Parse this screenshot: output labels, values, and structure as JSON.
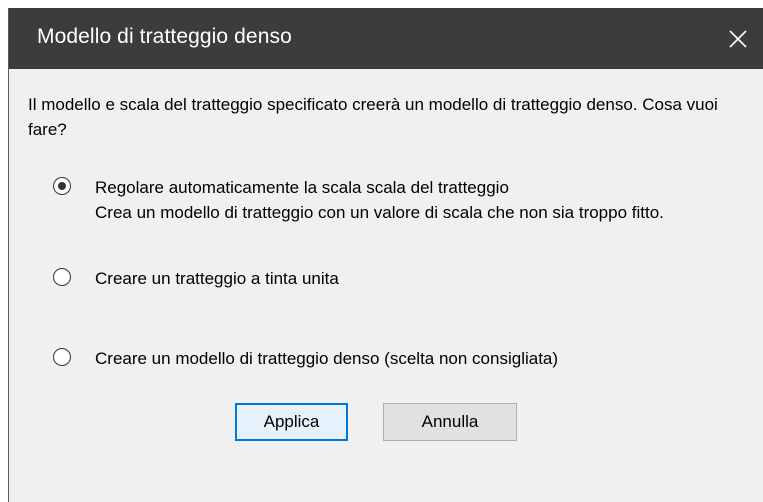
{
  "dialog": {
    "title": "Modello di tratteggio denso",
    "close_icon": "close-icon",
    "message": "Il modello e scala del tratteggio specificato creerà un modello di tratteggio denso. Cosa vuoi fare?",
    "options": [
      {
        "label": "Regolare automaticamente la scala scala del tratteggio",
        "description": "Crea un modello di tratteggio con un valore di scala che non sia troppo fitto.",
        "checked": true
      },
      {
        "label": "Creare un tratteggio a tinta unita",
        "checked": false
      },
      {
        "label": "Creare un modello di tratteggio denso (scelta non consigliata)",
        "checked": false
      }
    ],
    "buttons": {
      "apply": "Applica",
      "cancel": "Annulla"
    },
    "colors": {
      "titlebar": "#3c3c3c",
      "background": "#f0f0f0",
      "default_button_border": "#0078d7"
    }
  }
}
